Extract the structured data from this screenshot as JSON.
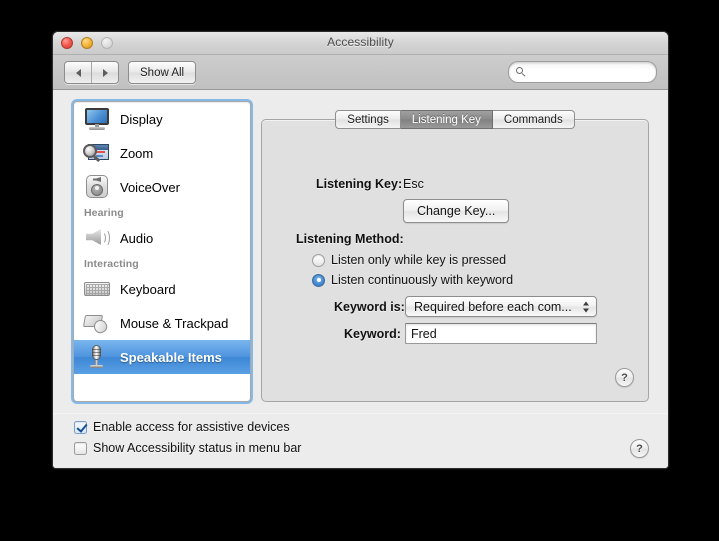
{
  "window": {
    "title": "Accessibility",
    "traffic_lights": [
      "close-button",
      "minimize-button",
      "zoom-button"
    ]
  },
  "toolbar": {
    "back_label": "◀",
    "forward_label": "▶",
    "show_all_label": "Show All",
    "search_placeholder": "",
    "search_value": "",
    "search_icon": "search-icon"
  },
  "sidebar": {
    "items": [
      {
        "label": "Display",
        "icon": "display-icon",
        "type": "item",
        "selected": false
      },
      {
        "label": "Zoom",
        "icon": "zoom-magnifier-icon",
        "type": "item",
        "selected": false
      },
      {
        "label": "VoiceOver",
        "icon": "voiceover-icon",
        "type": "item",
        "selected": false
      },
      {
        "label": "Hearing",
        "icon": "",
        "type": "group",
        "selected": false
      },
      {
        "label": "Audio",
        "icon": "speaker-icon",
        "type": "item",
        "selected": false
      },
      {
        "label": "Interacting",
        "icon": "",
        "type": "group",
        "selected": false
      },
      {
        "label": "Keyboard",
        "icon": "keyboard-icon",
        "type": "item",
        "selected": false
      },
      {
        "label": "Mouse & Trackpad",
        "icon": "mouse-trackpad-icon",
        "type": "item",
        "selected": false
      },
      {
        "label": "Speakable Items",
        "icon": "microphone-icon",
        "type": "item",
        "selected": true
      }
    ],
    "selection_color": "#3d87d5"
  },
  "main": {
    "tabs": [
      {
        "label": "Settings",
        "active": false
      },
      {
        "label": "Listening Key",
        "active": true
      },
      {
        "label": "Commands",
        "active": false
      }
    ],
    "listening_key": {
      "label": "Listening Key:",
      "value": "Esc",
      "change_button": "Change Key..."
    },
    "listening_method": {
      "label": "Listening Method:",
      "options": [
        {
          "label": "Listen only while key is pressed",
          "selected": false
        },
        {
          "label": "Listen continuously with keyword",
          "selected": true
        }
      ],
      "keyword_is_label": "Keyword is:",
      "keyword_is_value": "Required before each com...",
      "keyword_label": "Keyword:",
      "keyword_value": "Fred"
    },
    "panel_help_label": "?"
  },
  "footer": {
    "checkboxes": [
      {
        "label": "Enable access for assistive devices",
        "checked": true
      },
      {
        "label": "Show Accessibility status in menu bar",
        "checked": false
      }
    ],
    "help_label": "?"
  }
}
